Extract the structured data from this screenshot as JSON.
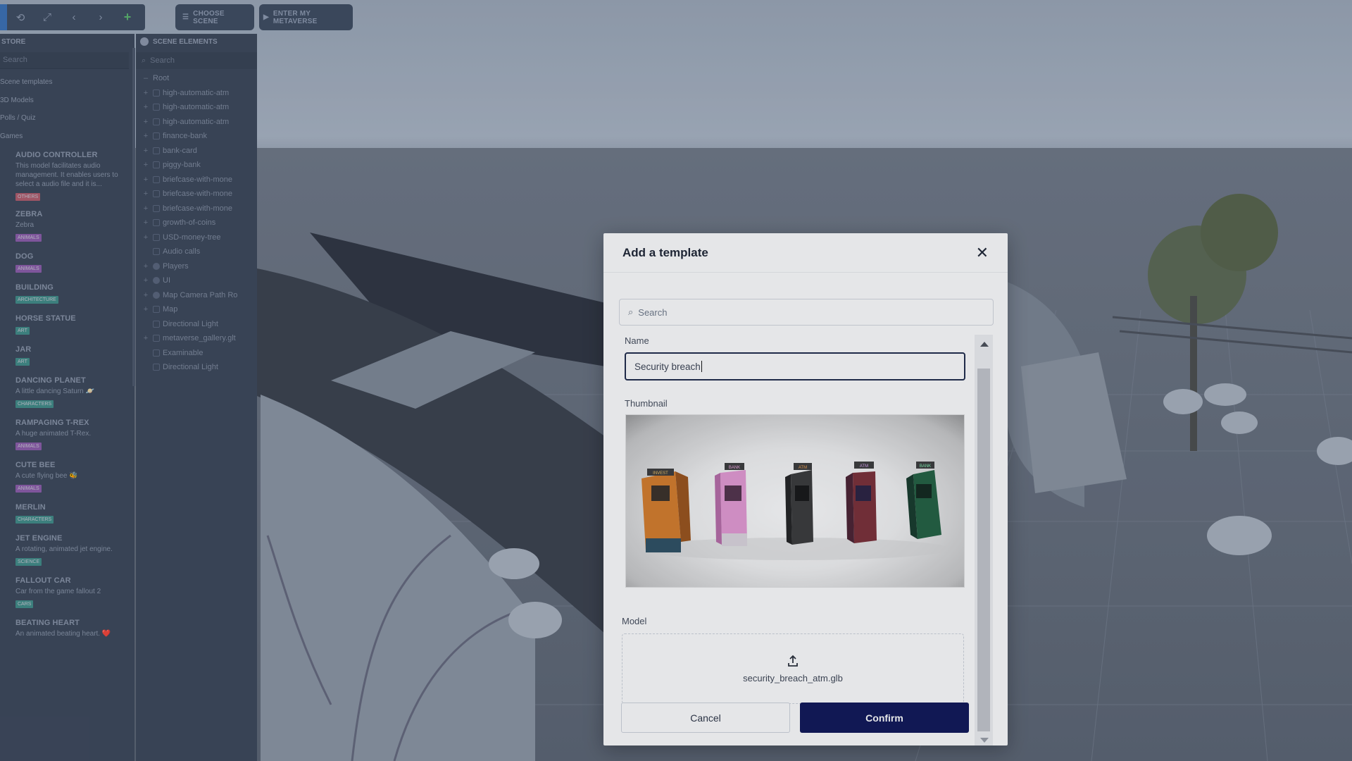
{
  "toolbar": {
    "buttons": [
      "sync-icon",
      "expand-icon",
      "chevron-left-icon",
      "chevron-right-icon",
      "plus-icon"
    ],
    "choose_scene": "CHOOSE SCENE",
    "enter_metaverse": "ENTER MY METAVERSE"
  },
  "store": {
    "title": "STORE",
    "search_placeholder": "Search",
    "categories": [
      "Scene templates",
      "3D Models",
      "Polls / Quiz",
      "Games"
    ],
    "items": [
      {
        "name": "AUDIO CONTROLLER",
        "desc": "This model facilitates audio management. It enables users to select a audio file and it is...",
        "tag": "OTHERS",
        "tag_color": "#b05a6a"
      },
      {
        "name": "ZEBRA",
        "desc": "Zebra",
        "tag": "ANIMALS",
        "tag_color": "#8a5aa8"
      },
      {
        "name": "DOG",
        "desc": "",
        "tag": "ANIMALS",
        "tag_color": "#8a5aa8"
      },
      {
        "name": "BUILDING",
        "desc": "",
        "tag": "ARCHITECTURE",
        "tag_color": "#3f8a86"
      },
      {
        "name": "HORSE STATUE",
        "desc": "",
        "tag": "ART",
        "tag_color": "#3f8a86"
      },
      {
        "name": "JAR",
        "desc": "",
        "tag": "ART",
        "tag_color": "#3f8a86"
      },
      {
        "name": "DANCING PLANET",
        "desc": "A little dancing Saturn 🪐",
        "tag": "CHARACTERS",
        "tag_color": "#3f8a86"
      },
      {
        "name": "RAMPAGING T-REX",
        "desc": "A huge animated T-Rex.",
        "tag": "ANIMALS",
        "tag_color": "#8a5aa8"
      },
      {
        "name": "CUTE BEE",
        "desc": "A cute flying bee 🐝",
        "tag": "ANIMALS",
        "tag_color": "#8a5aa8"
      },
      {
        "name": "MERLIN",
        "desc": "",
        "tag": "CHARACTERS",
        "tag_color": "#3f8a86"
      },
      {
        "name": "JET ENGINE",
        "desc": "A rotating, animated jet engine.",
        "tag": "SCIENCE",
        "tag_color": "#3f8a86"
      },
      {
        "name": "FALLOUT CAR",
        "desc": "Car from the game fallout 2",
        "tag": "CARS",
        "tag_color": "#3f8a86"
      },
      {
        "name": "BEATING HEART",
        "desc": "An animated beating heart. ❤️",
        "tag": "",
        "tag_color": "#3f8a86"
      }
    ]
  },
  "elements": {
    "title": "SCENE ELEMENTS",
    "search_placeholder": "Search",
    "root": "Root",
    "rows": [
      {
        "label": "high-automatic-atm",
        "expand": true,
        "round": false
      },
      {
        "label": "high-automatic-atm",
        "expand": true,
        "round": false
      },
      {
        "label": "high-automatic-atm",
        "expand": true,
        "round": false
      },
      {
        "label": "finance-bank",
        "expand": true,
        "round": false
      },
      {
        "label": "bank-card",
        "expand": true,
        "round": false
      },
      {
        "label": "piggy-bank",
        "expand": true,
        "round": false
      },
      {
        "label": "briefcase-with-mone",
        "expand": true,
        "round": false
      },
      {
        "label": "briefcase-with-mone",
        "expand": true,
        "round": false
      },
      {
        "label": "briefcase-with-mone",
        "expand": true,
        "round": false
      },
      {
        "label": "growth-of-coins",
        "expand": true,
        "round": false
      },
      {
        "label": "USD-money-tree",
        "expand": true,
        "round": false
      },
      {
        "label": "Audio calls",
        "expand": false,
        "round": false
      },
      {
        "label": "Players",
        "expand": true,
        "round": true
      },
      {
        "label": "UI",
        "expand": true,
        "round": true
      },
      {
        "label": "Map Camera Path Ro",
        "expand": true,
        "round": true
      },
      {
        "label": "Map",
        "expand": true,
        "round": false
      },
      {
        "label": "Directional Light",
        "expand": false,
        "round": false
      },
      {
        "label": "metaverse_gallery.glt",
        "expand": true,
        "round": false
      },
      {
        "label": "Examinable",
        "expand": false,
        "round": false
      },
      {
        "label": "Directional Light",
        "expand": false,
        "round": false
      }
    ]
  },
  "modal": {
    "title": "Add a template",
    "search_placeholder": "Search",
    "name_label": "Name",
    "name_value": "Security breach",
    "thumbnail_label": "Thumbnail",
    "atm_labels": [
      "INVEST",
      "BANK",
      "ATM",
      "ATM",
      "BANK"
    ],
    "model_label": "Model",
    "model_file": "security_breach_atm.glb",
    "cancel": "Cancel",
    "confirm": "Confirm"
  }
}
